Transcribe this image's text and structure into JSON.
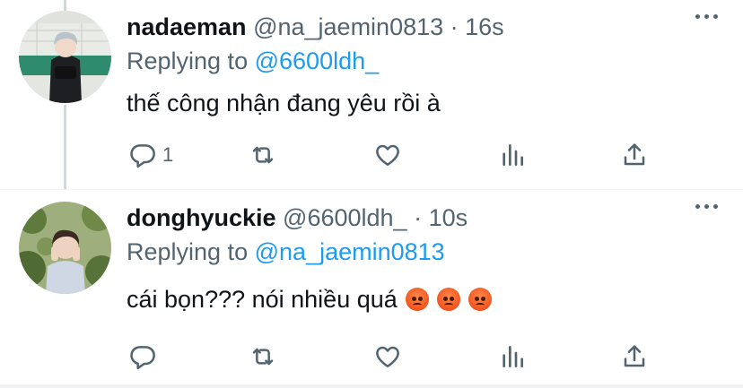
{
  "tweets": [
    {
      "display_name": "nadaeman",
      "handle": "@na_jaemin0813",
      "time": "· 16s",
      "replying_prefix": "Replying to",
      "replying_to": "@6600ldh_",
      "text": "thế công nhận đang yêu rồi à",
      "reply_count": "1",
      "avatar_colors": {
        "bg": "#e9ebe6",
        "tile": "#2f8b6e",
        "hair": "#b9c3cc",
        "jacket": "#1e1f22"
      }
    },
    {
      "display_name": "donghyuckie",
      "handle": "@6600ldh_",
      "time": "· 10s",
      "replying_prefix": "Replying to",
      "replying_to": "@na_jaemin0813",
      "text": "cái bọn??? nói nhiều quá",
      "reply_count": "",
      "emoji": [
        "angry-face",
        "angry-face",
        "angry-face"
      ],
      "avatar_colors": {
        "bg": "#9eae7c",
        "leaf": "#5e7a3c",
        "hair": "#3a2a22",
        "shirt": "#cfd6e4"
      }
    }
  ],
  "colors": {
    "accent": "#1d9bf0",
    "muted": "#536471",
    "text": "#0f1419",
    "thread": "#cfd9de"
  }
}
